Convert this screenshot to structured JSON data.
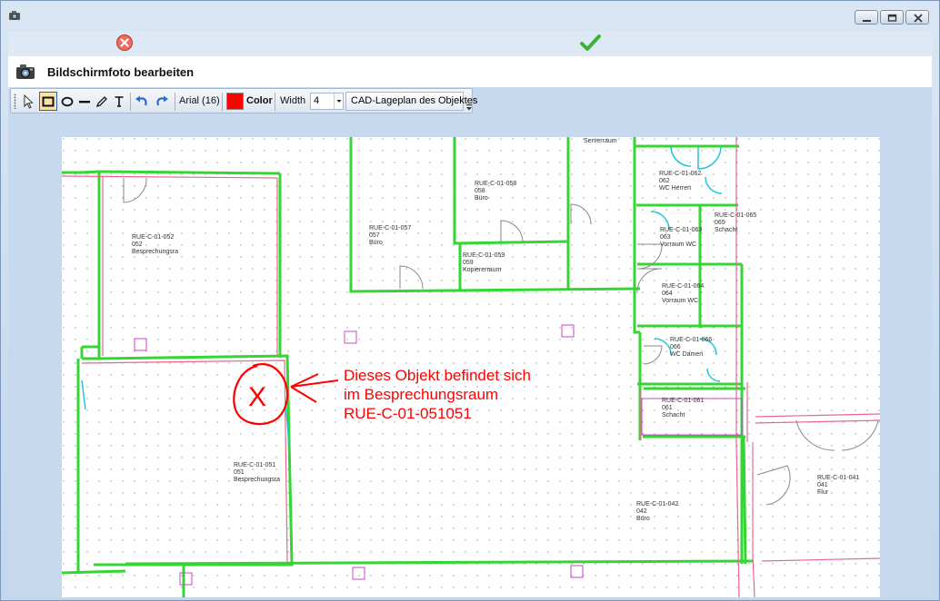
{
  "header": {
    "title": "Bildschirmfoto bearbeiten"
  },
  "toolbar": {
    "font": "Arial (16)",
    "color_label": "Color",
    "width_label": "Width",
    "width_value": "4",
    "layer": "CAD-Lageplan des Objektes"
  },
  "colors": {
    "accent": "#ff0000",
    "wall": "#34d634",
    "door": "#22c4dc"
  },
  "plan": {
    "rooms": [
      {
        "id": "RUE-C-01-052",
        "number": "052",
        "name": "Besprechungsra"
      },
      {
        "id": "RUE-C-01-057",
        "number": "057",
        "name": "Büro"
      },
      {
        "id": "RUE-C-01-058",
        "number": "058",
        "name": "Büro"
      },
      {
        "id": "RUE-C-01-059",
        "number": "059",
        "name": "Kopiererraum"
      },
      {
        "id": "RUE-C-01-062",
        "number": "062",
        "name": "WC Herren"
      },
      {
        "id": "RUE-C-01-063",
        "number": "063",
        "name": "Vorraum WC"
      },
      {
        "id": "RUE-C-01-065",
        "number": "065",
        "name": "Schacht"
      },
      {
        "id": "RUE-C-01-064",
        "number": "064",
        "name": "Vorraum WC"
      },
      {
        "id": "RUE-C-01-066",
        "number": "066",
        "name": "WC Damen"
      },
      {
        "id": "RUE-C-01-061",
        "number": "061",
        "name": "Schacht"
      },
      {
        "id": "RUE-C-01-051",
        "number": "051",
        "name": "Besprechungsra"
      },
      {
        "id": "RUE-C-01-042",
        "number": "042",
        "name": "Büro"
      },
      {
        "id": "RUE-C-01-041",
        "number": "041",
        "name": "Flur"
      }
    ],
    "serverraum": "Serverraum"
  },
  "annotation": {
    "mark": "X",
    "lines": [
      "Dieses Objekt befindet sich",
      "im Besprechungsraum",
      "RUE-C-01-051051"
    ]
  }
}
